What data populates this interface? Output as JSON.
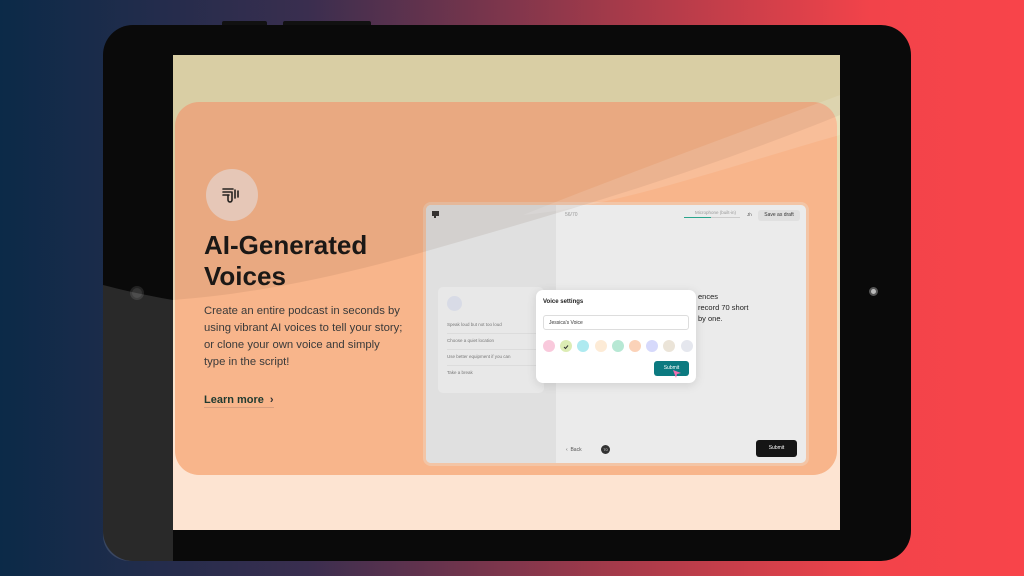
{
  "feature": {
    "icon": "voice-wave-icon",
    "title": "AI-Generated Voices",
    "description": "Create an entire podcast in seconds by using vibrant AI voices to tell your story; or clone your own voice and simply type in the script!",
    "learn_more": "Learn more"
  },
  "app": {
    "progress": "56/70",
    "microphone": "Microphone (built-in)",
    "avatar": "Jh",
    "save_draft": "Save as draft",
    "tips": [
      "Speak loud but not too loud",
      "Choose a quiet location",
      "Use better equipment if you can",
      "Take a break"
    ],
    "instruction_partial": [
      "ences",
      "record 70 short",
      "by one."
    ],
    "back": "Back",
    "count": "70",
    "submit": "Submit",
    "modal": {
      "title": "Voice settings",
      "input_value": "Jessica's Voice",
      "colors": [
        "#f9c9dc",
        "#dcecb4",
        "#aeeaf0",
        "#fdebd6",
        "#b7e8d4",
        "#fbd2b8",
        "#d6d9fb",
        "#ebe4d8",
        "#e5e7ee"
      ],
      "selected_color_index": 1,
      "submit": "Submit",
      "accent": "#0c7a80"
    }
  }
}
